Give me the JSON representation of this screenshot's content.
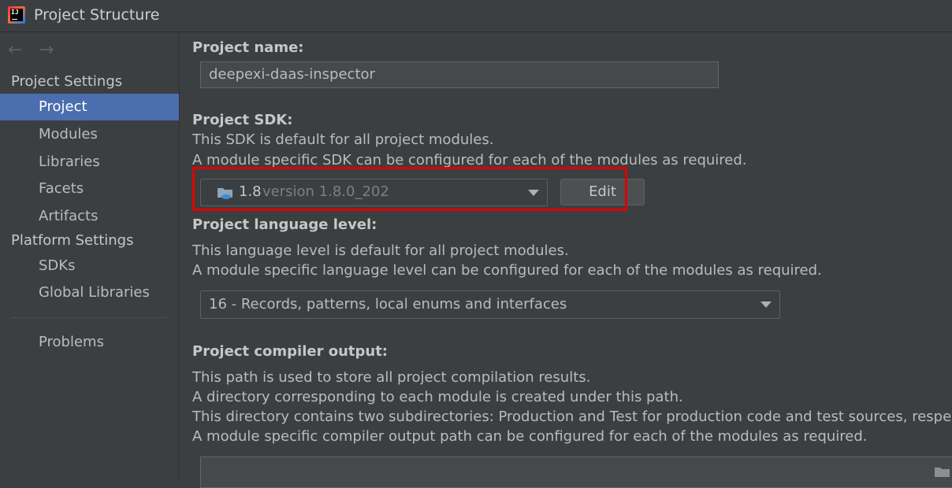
{
  "window": {
    "title": "Project Structure",
    "app_icon_text": "IJ"
  },
  "sidebar": {
    "nav": {
      "back_icon": "arrow-left",
      "forward_icon": "arrow-right",
      "back_glyph": "←",
      "forward_glyph": "→"
    },
    "project_settings_header": "Project Settings",
    "project_items": [
      {
        "label": "Project",
        "selected": true
      },
      {
        "label": "Modules"
      },
      {
        "label": "Libraries"
      },
      {
        "label": "Facets"
      },
      {
        "label": "Artifacts"
      }
    ],
    "platform_settings_header": "Platform Settings",
    "platform_items": [
      {
        "label": "SDKs"
      },
      {
        "label": "Global Libraries"
      }
    ],
    "problems_label": "Problems",
    "selected_color": "#4b6eaf"
  },
  "main": {
    "project_name": {
      "label": "Project name:",
      "value": "deepexi-daas-inspector"
    },
    "project_sdk": {
      "label": "Project SDK:",
      "desc1": "This SDK is default for all project modules.",
      "desc2": "A module specific SDK can be configured for each of the modules as required.",
      "sdk_name": "1.8",
      "sdk_version": "version 1.8.0_202",
      "edit_label": "Edit",
      "highlight_color": "#e00000"
    },
    "language_level": {
      "label": "Project language level:",
      "desc1": "This language level is default for all project modules.",
      "desc2": "A module specific language level can be configured for each of the modules as required.",
      "value": "16 - Records, patterns, local enums and interfaces"
    },
    "compiler_output": {
      "label": "Project compiler output:",
      "desc1": "This path is used to store all project compilation results.",
      "desc2": "A directory corresponding to each module is created under this path.",
      "desc3": "This directory contains two subdirectories: Production and Test for production code and test sources, respectively",
      "desc4": "A module specific compiler output path can be configured for each of the modules as required.",
      "value": ""
    }
  },
  "colors": {
    "background": "#3c3f41",
    "text": "#bbbbbb",
    "field_bg": "#45494a"
  }
}
